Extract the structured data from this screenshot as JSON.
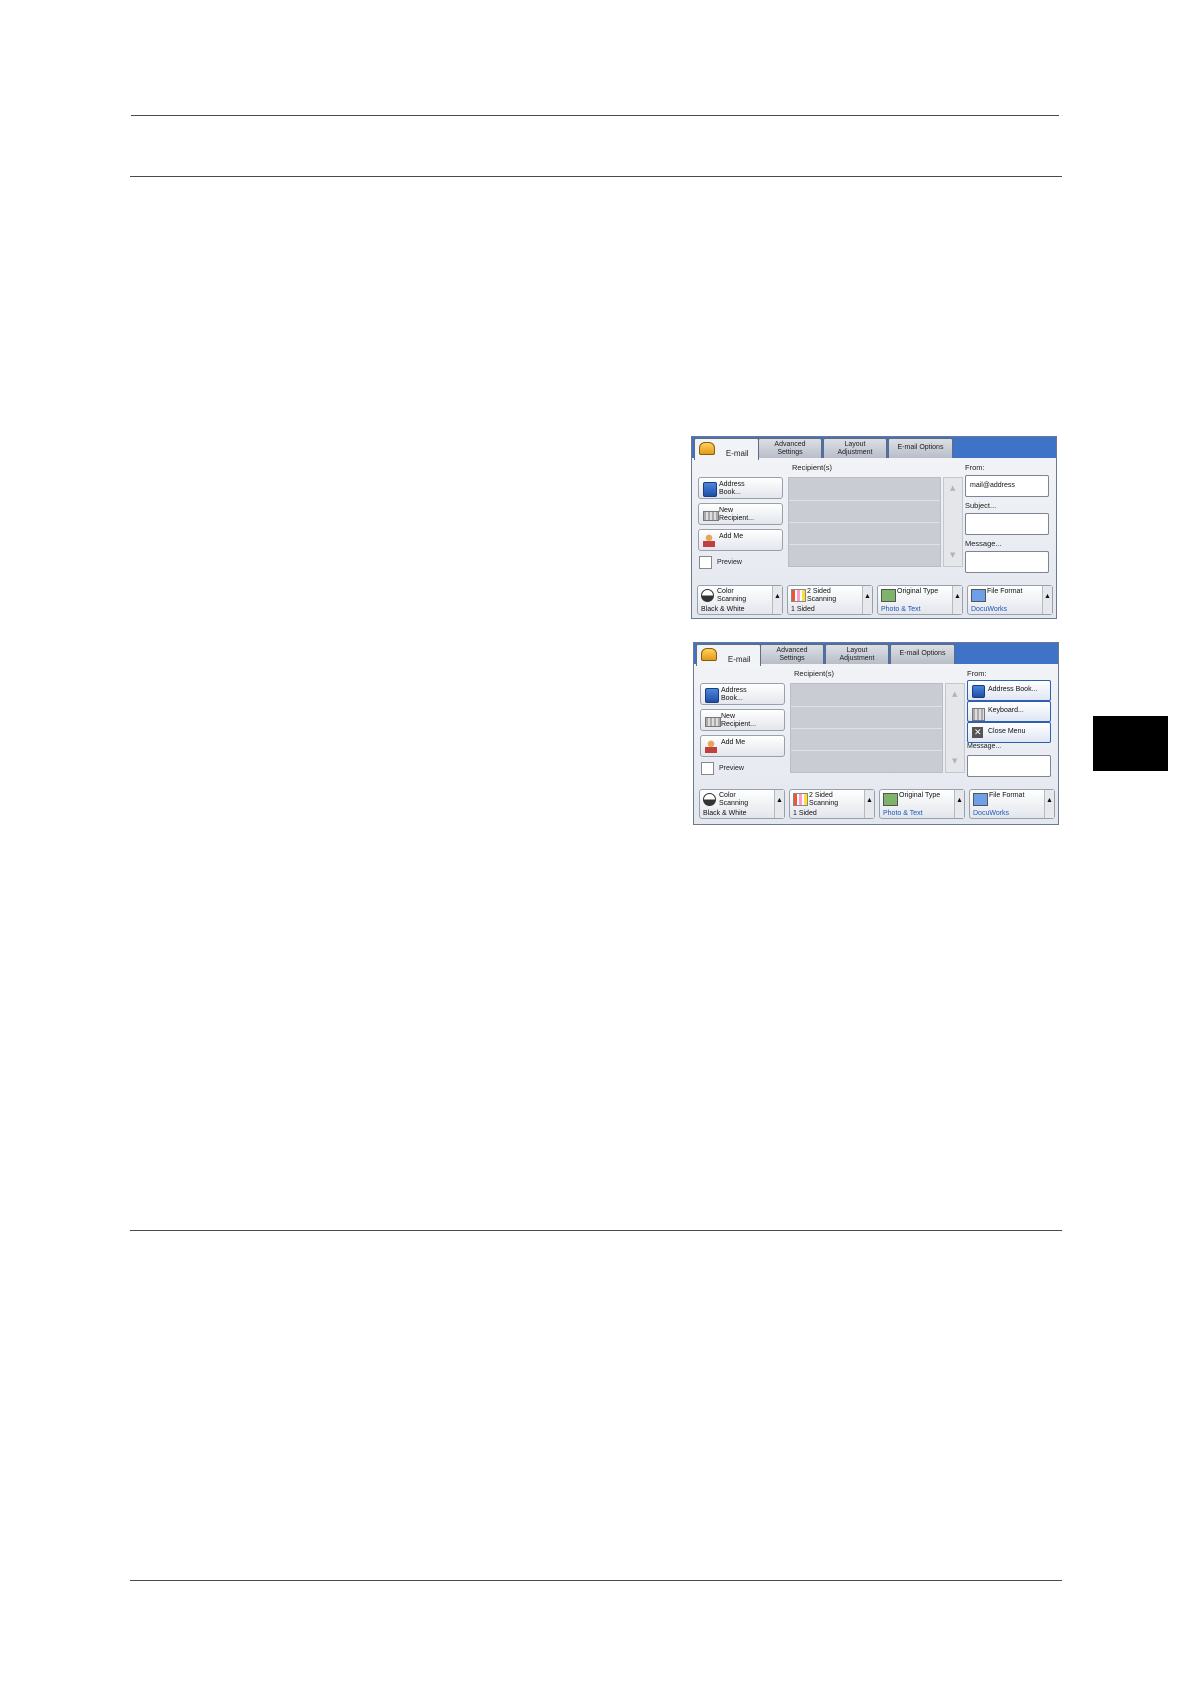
{
  "panel1": {
    "tabs": [
      "E-mail",
      "Advanced\nSettings",
      "Layout\nAdjustment",
      "E-mail Options"
    ],
    "recipients_label": "Recipient(s)",
    "buttons": {
      "address_book": "Address\nBook...",
      "new_recipient": "New\nRecipient...",
      "add_me": "Add Me",
      "preview": "Preview"
    },
    "from_label": "From:",
    "from_value": "mail@address",
    "subject_label": "Subject...",
    "message_label": "Message...",
    "features": [
      {
        "title": "Color\nScanning",
        "value": "Black & White"
      },
      {
        "title": "2 Sided\nScanning",
        "value": "1 Sided"
      },
      {
        "title": "Original Type",
        "value": "Photo & Text"
      },
      {
        "title": "File Format",
        "value": "DocuWorks"
      }
    ]
  },
  "panel2": {
    "tabs": [
      "E-mail",
      "Advanced\nSettings",
      "Layout\nAdjustment",
      "E-mail Options"
    ],
    "recipients_label": "Recipient(s)",
    "buttons": {
      "address_book": "Address\nBook...",
      "new_recipient": "New\nRecipient...",
      "add_me": "Add Me",
      "preview": "Preview"
    },
    "from_label": "From:",
    "from_menu": [
      "Address Book...",
      "Keyboard...",
      "Close Menu"
    ],
    "message_label": "Message...",
    "features": [
      {
        "title": "Color\nScanning",
        "value": "Black & White"
      },
      {
        "title": "2 Sided\nScanning",
        "value": "1 Sided"
      },
      {
        "title": "Original Type",
        "value": "Photo & Text"
      },
      {
        "title": "File Format",
        "value": "DocuWorks"
      }
    ]
  },
  "colors": {
    "tabbar": "#3f73c7",
    "side_tab": "#000000",
    "link_blue": "#1e56b4"
  }
}
